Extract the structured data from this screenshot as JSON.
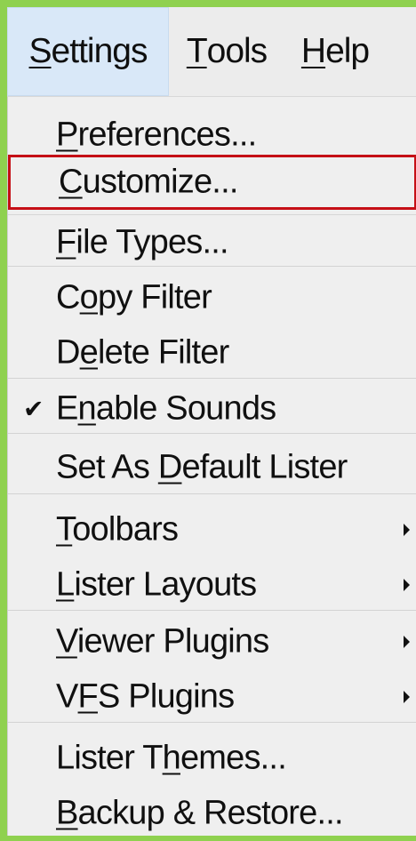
{
  "window": {
    "menu_bar": [
      {
        "label_parts": [
          "S",
          "ettings"
        ],
        "active": true
      },
      {
        "label_parts": [
          "T",
          "ools"
        ],
        "active": false
      },
      {
        "label_parts": [
          "H",
          "elp"
        ],
        "active": false
      }
    ]
  },
  "menu": {
    "items": [
      {
        "parts": [
          "P",
          "references..."
        ]
      },
      {
        "parts": [
          "C",
          "ustomize..."
        ],
        "highlighted": true
      },
      {
        "parts": [
          "F",
          "ile Types..."
        ]
      },
      {
        "parts": [
          "C",
          "o",
          "py Filter"
        ]
      },
      {
        "parts": [
          "D",
          "e",
          "lete Filter"
        ]
      },
      {
        "parts": [
          "E",
          "n",
          "able Sounds"
        ],
        "checked": true
      },
      {
        "parts": [
          "Set As ",
          "D",
          "efault Lister"
        ]
      },
      {
        "parts": [
          "T",
          "oolbars"
        ],
        "submenu": true
      },
      {
        "parts": [
          "L",
          "ister Layouts"
        ],
        "submenu": true
      },
      {
        "parts": [
          "V",
          "iewer Plugins"
        ],
        "submenu": true
      },
      {
        "parts": [
          "V",
          "F",
          "S Plugins"
        ],
        "submenu": true
      },
      {
        "parts": [
          "Lister T",
          "h",
          "emes..."
        ]
      },
      {
        "parts": [
          "B",
          "ackup & Restore..."
        ]
      }
    ]
  },
  "icons": {
    "check": "checkmark-icon",
    "submenu": "submenu-arrow-icon"
  },
  "colors": {
    "background_green": "#8fd14f",
    "menu_bg": "#efefef",
    "active_menu_bg": "#d9e8f8",
    "highlight_border": "#c50f16"
  }
}
